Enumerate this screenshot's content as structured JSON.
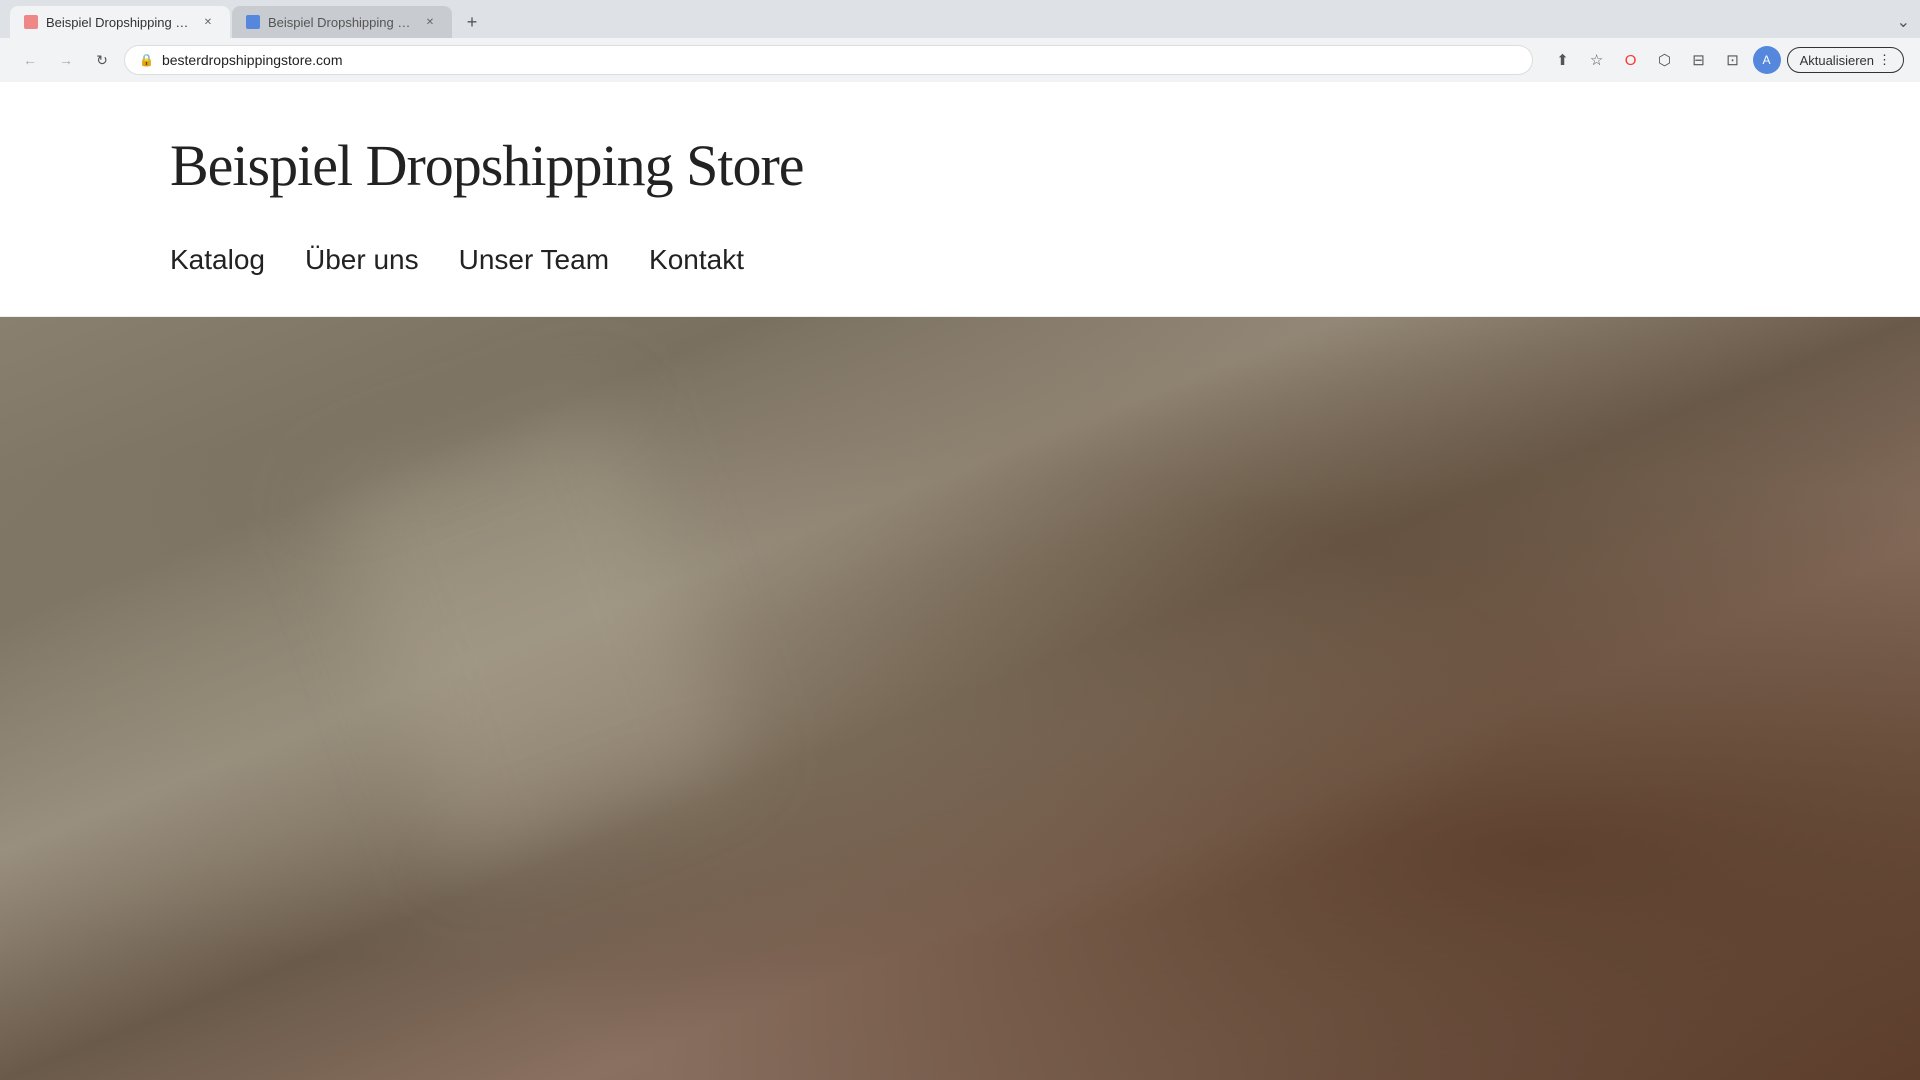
{
  "browser": {
    "tabs": [
      {
        "id": "tab1",
        "title": "Beispiel Dropshipping Store ·",
        "favicon_color": "red",
        "active": true
      },
      {
        "id": "tab2",
        "title": "Beispiel Dropshipping Store",
        "favicon_color": "blue",
        "active": false
      }
    ],
    "new_tab_label": "+",
    "tab_dropdown_label": "⌄",
    "url": "besterdropshippingstore.com",
    "nav": {
      "back_label": "←",
      "forward_label": "→",
      "reload_label": "↻"
    },
    "toolbar": {
      "share_icon": "⬆",
      "bookmark_icon": "☆",
      "opera_icon": "O",
      "extensions_icon": "⬡",
      "sidebar_icon": "⊟",
      "split_icon": "⊡",
      "profile_label": "A",
      "update_label": "Aktualisieren",
      "update_dropdown": "⋮"
    }
  },
  "site": {
    "title": "Beispiel Dropshipping Store",
    "nav": {
      "items": [
        {
          "id": "katalog",
          "label": "Katalog"
        },
        {
          "id": "ueber-uns",
          "label": "Über uns"
        },
        {
          "id": "unser-team",
          "label": "Unser Team"
        },
        {
          "id": "kontakt",
          "label": "Kontakt"
        }
      ]
    }
  }
}
